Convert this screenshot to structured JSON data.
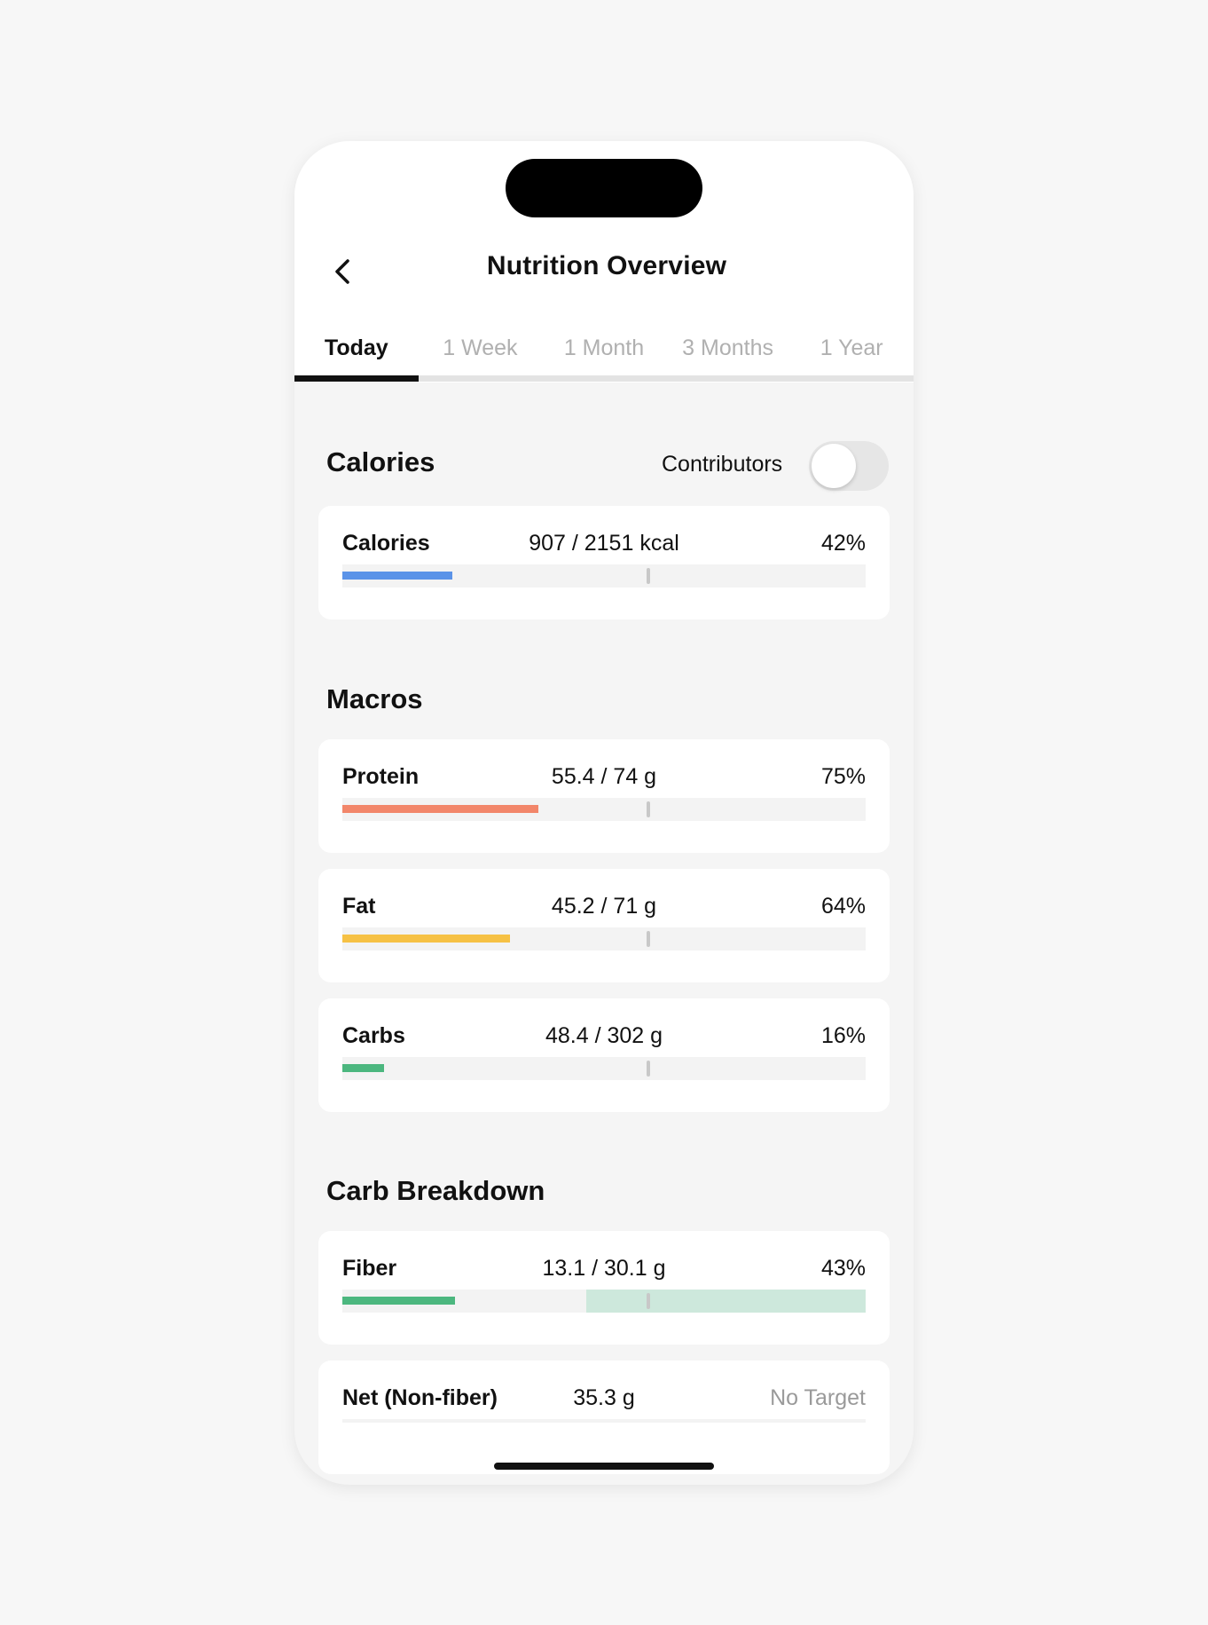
{
  "header": {
    "title": "Nutrition Overview",
    "back_icon": "chevron-left-icon"
  },
  "tabs": [
    {
      "label": "Today",
      "active": true
    },
    {
      "label": "1 Week",
      "active": false
    },
    {
      "label": "1 Month",
      "active": false
    },
    {
      "label": "3 Months",
      "active": false
    },
    {
      "label": "1 Year",
      "active": false
    }
  ],
  "calories_section": {
    "title": "Calories",
    "contributors_label": "Contributors",
    "contributors_on": false,
    "card": {
      "name": "Calories",
      "amount": "907 / 2151 kcal",
      "pct": "42%",
      "progress": 0.42,
      "color": "#5b93e8"
    }
  },
  "macros_section": {
    "title": "Macros",
    "cards": [
      {
        "name": "Protein",
        "amount": "55.4 / 74 g",
        "pct": "75%",
        "progress": 0.75,
        "color": "#f2866a"
      },
      {
        "name": "Fat",
        "amount": "45.2 / 71 g",
        "pct": "64%",
        "progress": 0.64,
        "color": "#f6c144"
      },
      {
        "name": "Carbs",
        "amount": "48.4 / 302 g",
        "pct": "16%",
        "progress": 0.16,
        "color": "#4cb77f"
      }
    ]
  },
  "carb_breakdown_section": {
    "title": "Carb Breakdown",
    "fiber": {
      "name": "Fiber",
      "amount": "13.1 / 30.1 g",
      "pct": "43%",
      "progress": 0.43,
      "color": "#4cb77f",
      "target_band_color": "#cde8dc"
    },
    "net": {
      "name": "Net (Non-fiber)",
      "amount": "35.3 g",
      "pct": "No Target"
    }
  },
  "colors": {
    "accent": "#111111",
    "muted_text": "#b0b0b0",
    "card_bg": "#ffffff",
    "screen_bg": "#f5f5f5"
  }
}
